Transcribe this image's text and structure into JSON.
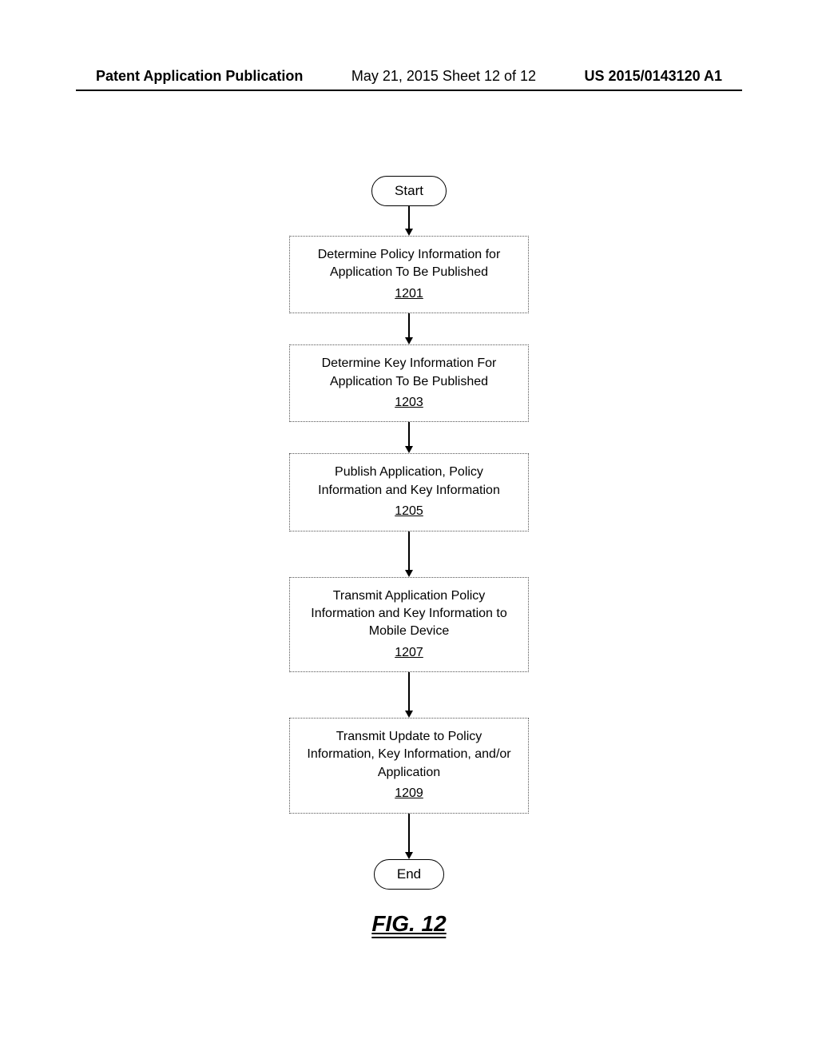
{
  "header": {
    "left": "Patent Application Publication",
    "center": "May 21, 2015  Sheet 12 of 12",
    "right": "US 2015/0143120 A1"
  },
  "chart_data": {
    "type": "flowchart",
    "title": "FIG. 12",
    "nodes": [
      {
        "id": "start",
        "type": "terminal",
        "label": "Start"
      },
      {
        "id": "1201",
        "type": "process",
        "label": "Determine Policy Information for Application To Be Published",
        "ref": "1201"
      },
      {
        "id": "1203",
        "type": "process",
        "label": "Determine Key Information For Application To Be Published",
        "ref": "1203"
      },
      {
        "id": "1205",
        "type": "process",
        "label": "Publish Application, Policy Information and Key Information",
        "ref": "1205"
      },
      {
        "id": "1207",
        "type": "process",
        "label": "Transmit Application Policy Information and Key Information to Mobile Device",
        "ref": "1207"
      },
      {
        "id": "1209",
        "type": "process",
        "label": "Transmit Update to Policy Information, Key Information, and/or Application",
        "ref": "1209"
      },
      {
        "id": "end",
        "type": "terminal",
        "label": "End"
      }
    ],
    "edges": [
      [
        "start",
        "1201"
      ],
      [
        "1201",
        "1203"
      ],
      [
        "1203",
        "1205"
      ],
      [
        "1205",
        "1207"
      ],
      [
        "1207",
        "1209"
      ],
      [
        "1209",
        "end"
      ]
    ]
  },
  "steps": {
    "start": "Start",
    "s1": {
      "text": "Determine Policy Information for Application To Be Published",
      "ref": "1201"
    },
    "s2": {
      "text": "Determine Key Information For Application To Be Published",
      "ref": "1203"
    },
    "s3": {
      "text": "Publish Application, Policy Information and Key Information",
      "ref": "1205"
    },
    "s4": {
      "text": "Transmit Application Policy Information and Key Information to Mobile Device",
      "ref": "1207"
    },
    "s5": {
      "text": "Transmit Update to Policy Information, Key Information, and/or Application",
      "ref": "1209"
    },
    "end": "End"
  },
  "figure_label": "FIG. 12"
}
